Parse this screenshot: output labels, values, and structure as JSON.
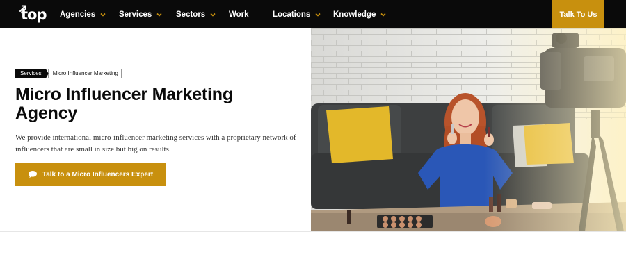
{
  "nav": {
    "logo_text": "top",
    "items": [
      {
        "label": "Agencies",
        "has_dropdown": true
      },
      {
        "label": "Services",
        "has_dropdown": true
      },
      {
        "label": "Sectors",
        "has_dropdown": true
      },
      {
        "label": "Work",
        "has_dropdown": false
      },
      {
        "label": "Locations",
        "has_dropdown": true
      },
      {
        "label": "Knowledge",
        "has_dropdown": true
      }
    ],
    "cta_label": "Talk To Us"
  },
  "hero": {
    "breadcrumb": [
      "Services",
      "Micro Influencer Marketing"
    ],
    "title": "Micro Influencer Marketing Agency",
    "description": "We provide international micro-influencer marketing services with a proprietary network of influencers that are small in size but big on results.",
    "cta_label": "Talk to a Micro Influencers Expert",
    "cta_icon": "chat-bubble-icon",
    "image": "influencer-makeup-photo"
  },
  "colors": {
    "nav_bg": "#0a0a0a",
    "accent": "#c8900e",
    "chevron": "#c8900e",
    "text": "#0a0a0a"
  }
}
